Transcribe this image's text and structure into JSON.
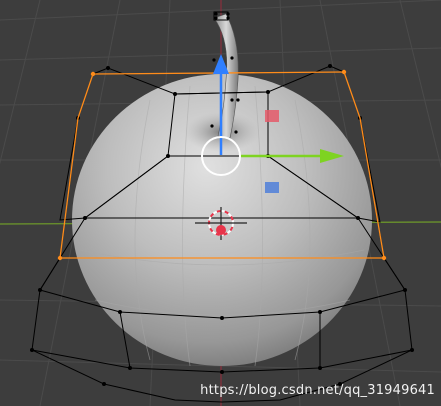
{
  "viewport": {
    "background": "#3d3d3d",
    "colors": {
      "grid": "#4b4b4b",
      "axis_x": "#8a2f3d",
      "axis_y": "#6e9a2a",
      "cage": "#000000",
      "selection": "#ff8c1a",
      "gizmo_y": "#7ed321",
      "gizmo_z": "#2f7fff",
      "plane_x": "#e55a6a",
      "plane_y": "#4f7fd9",
      "pivot_circle": "#ffffff",
      "cursor": "#e8344a"
    },
    "object_icons": [
      "apple-mesh-icon",
      "stem-mesh-icon",
      "lattice-cage-icon",
      "3d-cursor-icon",
      "move-gizmo-icon"
    ]
  },
  "watermark": {
    "text": "https://blog.csdn.net/qq_31949641"
  }
}
